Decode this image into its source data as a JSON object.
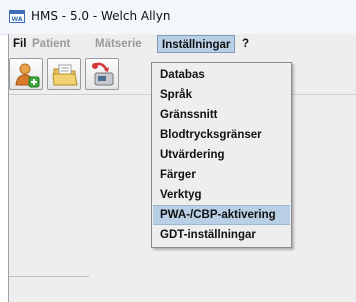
{
  "window": {
    "title": "HMS - 5.0 - Welch Allyn",
    "app_icon": "welch-allyn-app-icon"
  },
  "menubar": {
    "items": [
      {
        "label": "Fil",
        "enabled": true
      },
      {
        "label": "Patient",
        "enabled": false
      },
      {
        "label": "Mätserie",
        "enabled": false
      },
      {
        "label": "Inställningar",
        "enabled": true,
        "open": true
      },
      {
        "label": "?",
        "enabled": true
      }
    ]
  },
  "toolbar": {
    "buttons": [
      {
        "icon": "add-patient-icon"
      },
      {
        "icon": "open-folder-icon"
      },
      {
        "icon": "device-transfer-icon"
      }
    ]
  },
  "dropdown": {
    "items": [
      {
        "label": "Databas"
      },
      {
        "label": "Språk"
      },
      {
        "label": "Gränssnitt"
      },
      {
        "label": "Blodtrycksgränser"
      },
      {
        "label": "Utvärdering"
      },
      {
        "label": "Färger"
      },
      {
        "label": "Verktyg"
      },
      {
        "label": "PWA-/CBP-aktivering",
        "highlighted": true
      },
      {
        "label": "GDT-inställningar"
      }
    ]
  },
  "colors": {
    "highlight": "#b8cfe5",
    "highlight_border": "#7f9db9",
    "disabled_text": "#9a9a9a",
    "background": "#eeeeee"
  }
}
